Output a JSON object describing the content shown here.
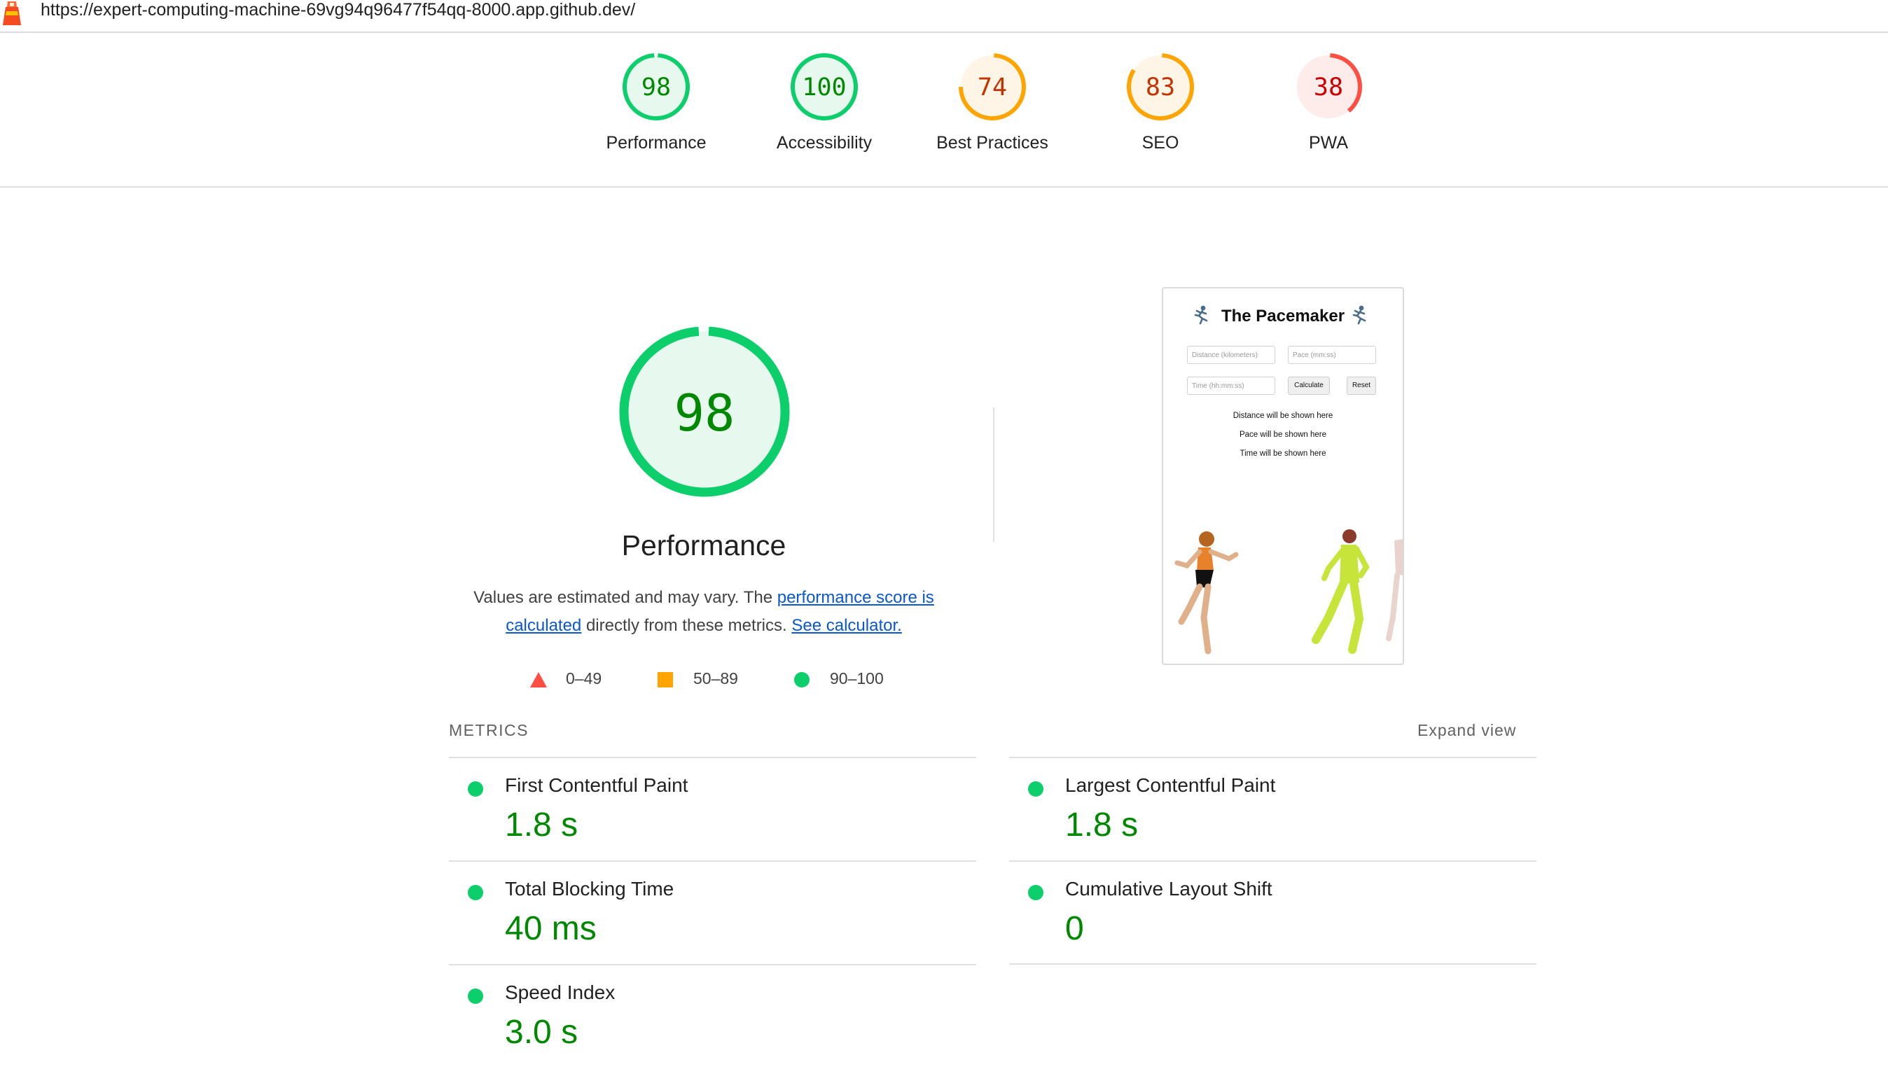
{
  "url": "https://expert-computing-machine-69vg94q96477f54qq-8000.app.github.dev/",
  "colors": {
    "pass": "#0cce6b",
    "pass_text": "#008800",
    "average": "#ffa400",
    "average_text": "#c33300",
    "fail": "#ff4e42",
    "fail_text": "#cc0000"
  },
  "categories": [
    {
      "score": "98",
      "label": "Performance",
      "rating": "pass"
    },
    {
      "score": "100",
      "label": "Accessibility",
      "rating": "pass"
    },
    {
      "score": "74",
      "label": "Best Practices",
      "rating": "average"
    },
    {
      "score": "83",
      "label": "SEO",
      "rating": "average"
    },
    {
      "score": "38",
      "label": "PWA",
      "rating": "fail"
    }
  ],
  "performance": {
    "score": "98",
    "title": "Performance",
    "desc_prefix": "Values are estimated and may vary. The ",
    "desc_link1": "performance score is calculated",
    "desc_middle": " directly from these metrics. ",
    "desc_link2": "See calculator."
  },
  "legend": [
    {
      "range": "0–49",
      "icon": "fail-triangle-icon"
    },
    {
      "range": "50–89",
      "icon": "average-square-icon"
    },
    {
      "range": "90–100",
      "icon": "pass-circle-icon"
    }
  ],
  "screenshot": {
    "title": "The Pacemaker",
    "distance_placeholder": "Distance (kilometers)",
    "pace_placeholder": "Pace (mm:ss)",
    "time_placeholder": "Time (hh:mm:ss)",
    "calculate": "Calculate",
    "reset": "Reset",
    "line1": "Distance will be shown here",
    "line2": "Pace will be shown here",
    "line3": "Time will be shown here",
    "icon": "runner-icon"
  },
  "metrics_heading": "METRICS",
  "expand_view": "Expand view",
  "metrics": [
    {
      "name": "First Contentful Paint",
      "value": "1.8 s"
    },
    {
      "name": "Largest Contentful Paint",
      "value": "1.8 s"
    },
    {
      "name": "Total Blocking Time",
      "value": "40 ms"
    },
    {
      "name": "Cumulative Layout Shift",
      "value": "0"
    },
    {
      "name": "Speed Index",
      "value": "3.0 s"
    }
  ]
}
